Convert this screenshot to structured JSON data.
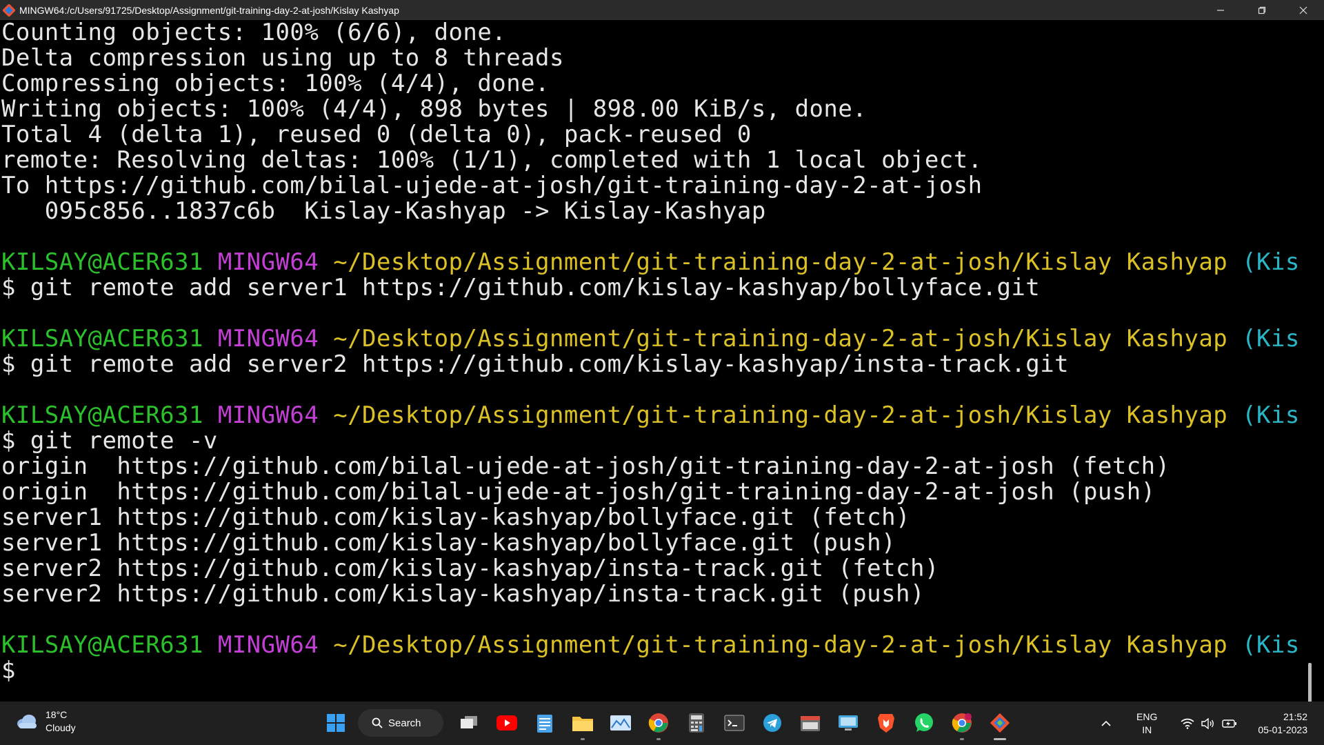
{
  "window": {
    "title": "MINGW64:/c/Users/91725/Desktop/Assignment/git-training-day-2-at-josh/Kislay Kashyap",
    "controls": {
      "minimize": "minimize",
      "maximize": "restore",
      "close": "close"
    }
  },
  "terminal": {
    "output_1": [
      "Counting objects: 100% (6/6), done.",
      "Delta compression using up to 8 threads",
      "Compressing objects: 100% (4/4), done.",
      "Writing objects: 100% (4/4), 898 bytes | 898.00 KiB/s, done.",
      "Total 4 (delta 1), reused 0 (delta 0), pack-reused 0",
      "remote: Resolving deltas: 100% (1/1), completed with 1 local object.",
      "To https://github.com/bilal-ujede-at-josh/git-training-day-2-at-josh",
      "   095c856..1837c6b  Kislay-Kashyap -> Kislay-Kashyap"
    ],
    "prompt": {
      "user": "KILSAY@ACER631",
      "host": "MINGW64",
      "path": "~/Desktop/Assignment/git-training-day-2-at-josh/Kislay Kashyap",
      "branch": "(Kis"
    },
    "commands": [
      "$ git remote add server1 https://github.com/kislay-kashyap/bollyface.git",
      "$ git remote add server2 https://github.com/kislay-kashyap/insta-track.git",
      "$ git remote -v",
      "$"
    ],
    "remote_list": [
      "origin  https://github.com/bilal-ujede-at-josh/git-training-day-2-at-josh (fetch)",
      "origin  https://github.com/bilal-ujede-at-josh/git-training-day-2-at-josh (push)",
      "server1 https://github.com/kislay-kashyap/bollyface.git (fetch)",
      "server1 https://github.com/kislay-kashyap/bollyface.git (push)",
      "server2 https://github.com/kislay-kashyap/insta-track.git (fetch)",
      "server2 https://github.com/kislay-kashyap/insta-track.git (push)"
    ]
  },
  "taskbar": {
    "weather": {
      "temp": "18°C",
      "condition": "Cloudy"
    },
    "search_label": "Search",
    "apps": [
      "start-icon",
      "task-view-icon",
      "youtube-icon",
      "notepad-icon",
      "file-explorer-icon",
      "photos-icon",
      "chrome-icon",
      "calculator-icon",
      "terminal-icon",
      "telegram-icon",
      "browser-window-icon",
      "remote-desktop-icon",
      "brave-icon",
      "whatsapp-icon",
      "chrome-profile-icon",
      "git-bash-icon"
    ],
    "tray": {
      "lang_top": "ENG",
      "lang_bottom": "IN",
      "time": "21:52",
      "date": "05-01-2023"
    }
  },
  "colors": {
    "prompt_user": "#2bc12b",
    "prompt_host": "#c33fd6",
    "prompt_path": "#dbc126",
    "prompt_branch": "#29b7c7",
    "terminal_text": "#e6e6e6",
    "terminal_bg": "#000000"
  }
}
